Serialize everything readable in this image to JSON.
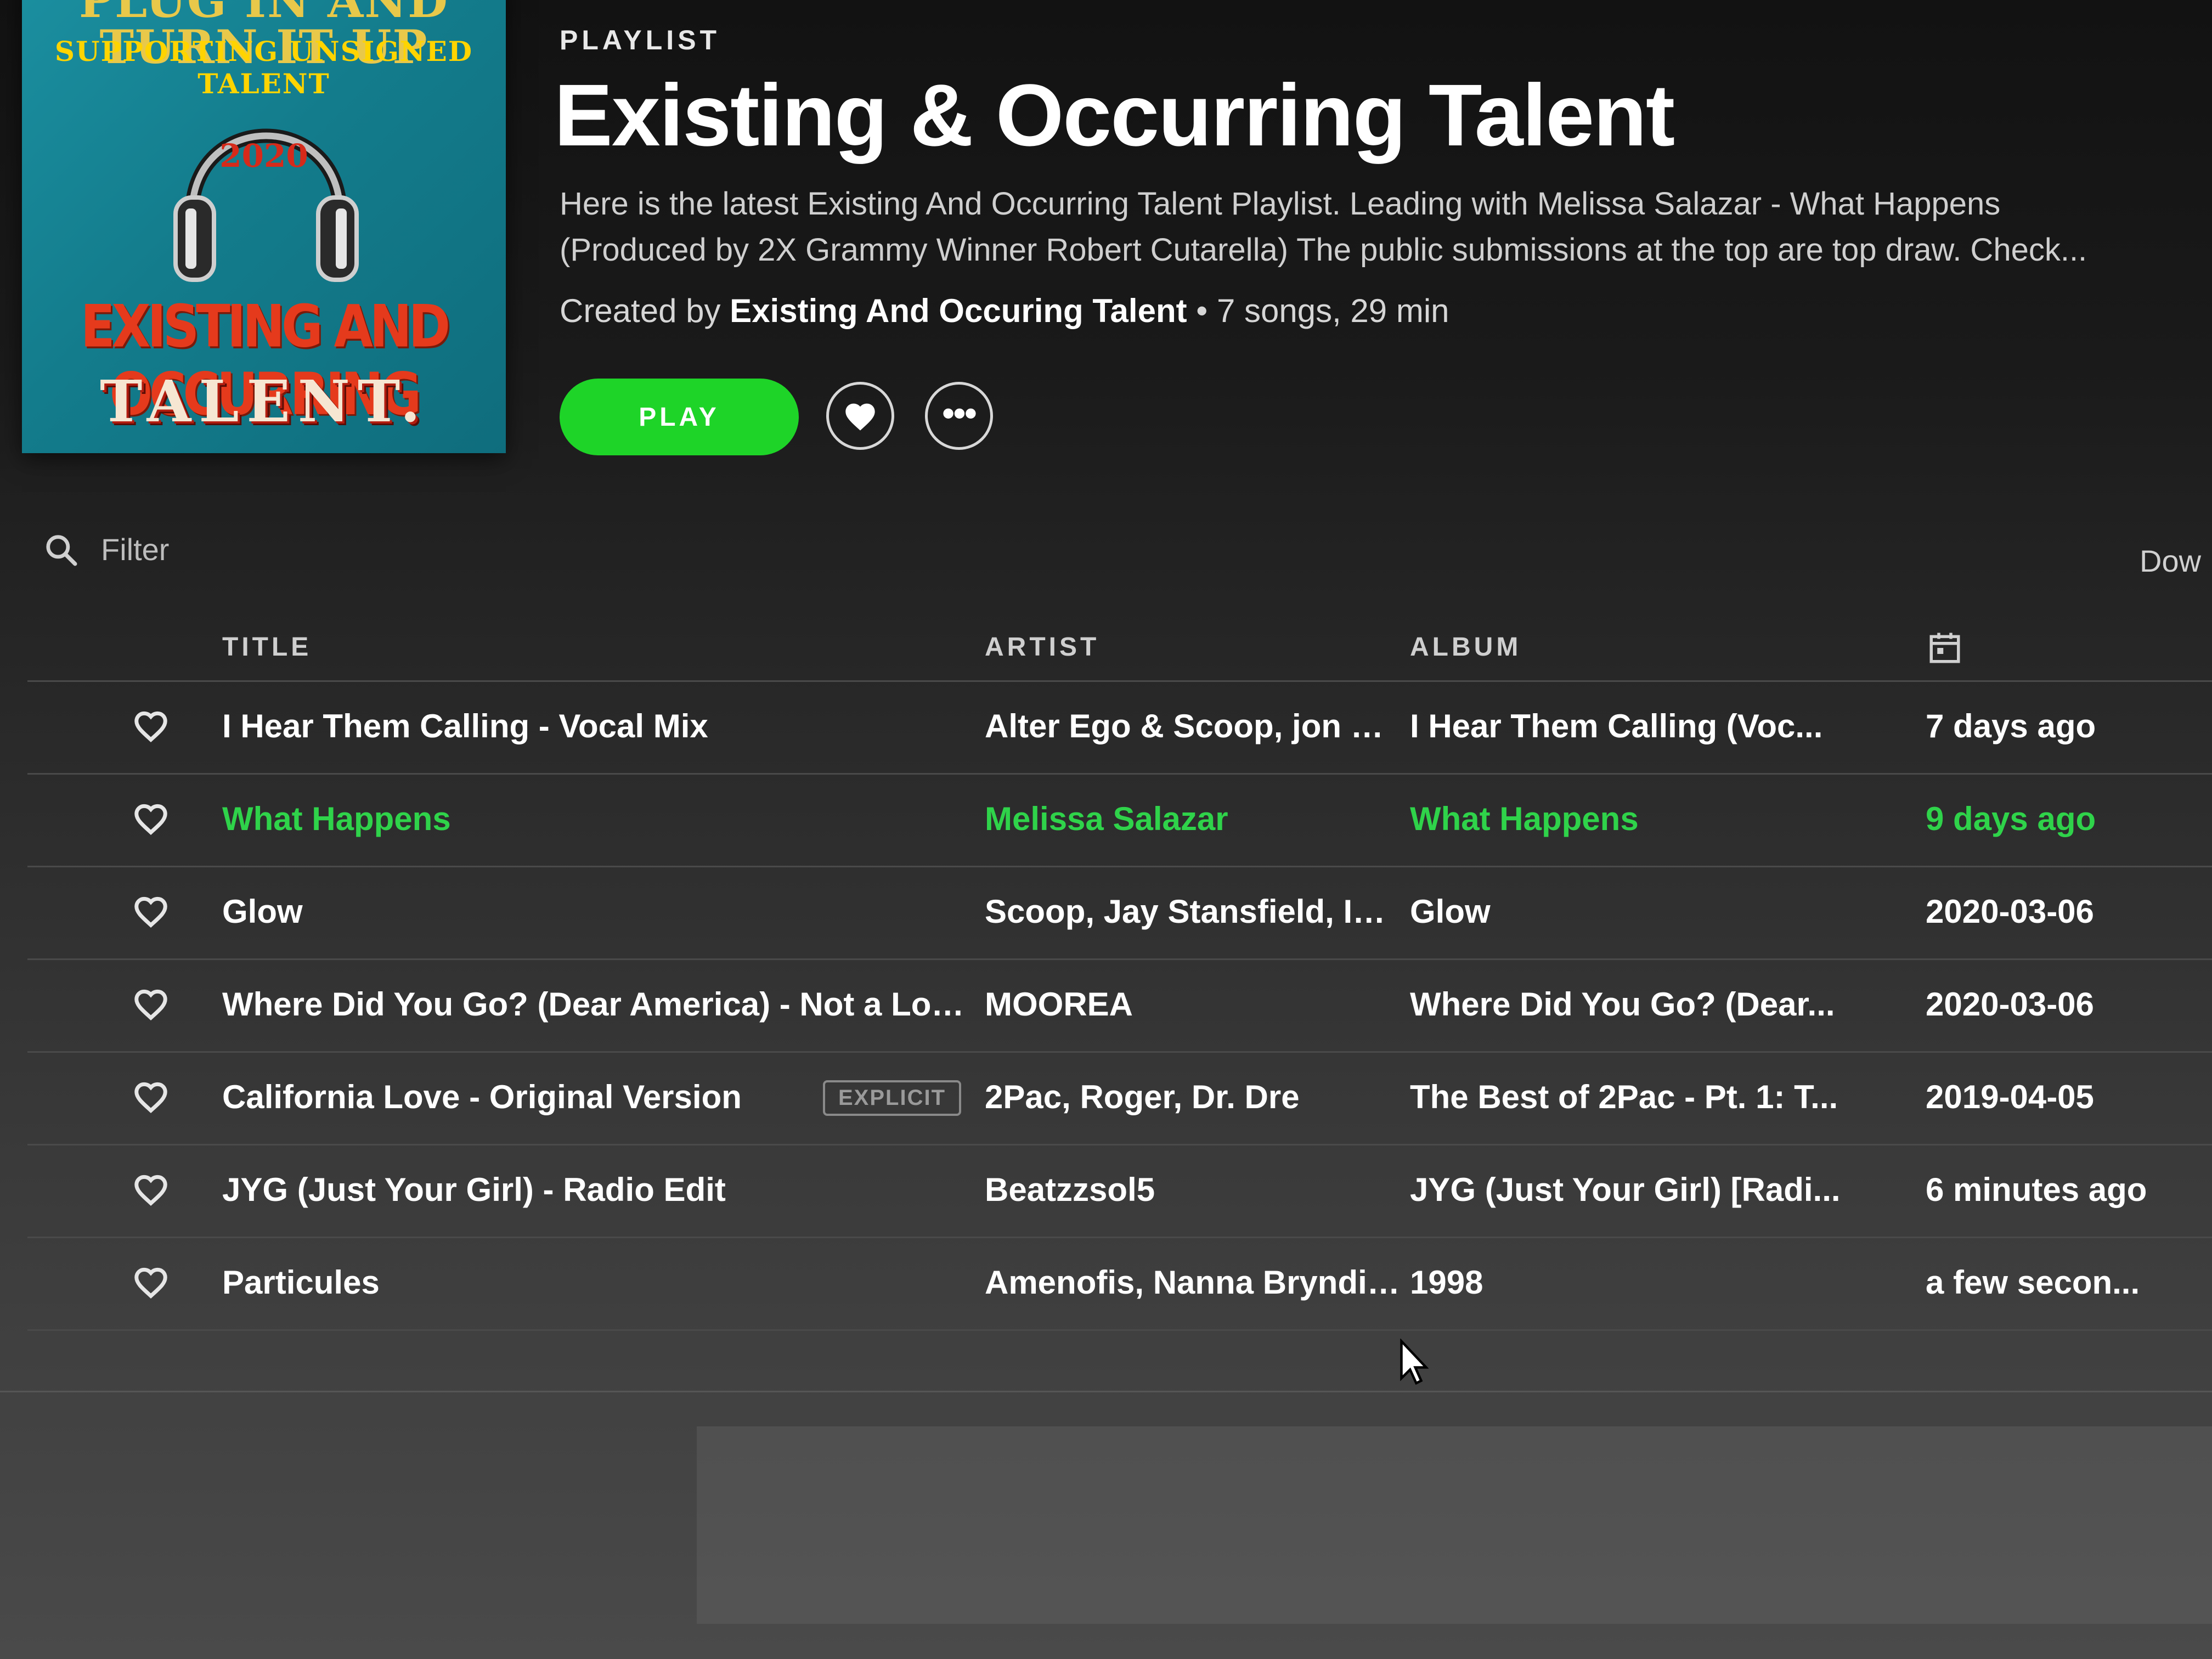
{
  "cover": {
    "line1": "PLUG IN AND TURN IT UP",
    "line2": "SUPPORTING UNSIGNED TALENT",
    "year": "2020",
    "name1": "EXISTING AND OCCURRING",
    "name2": "TALENT."
  },
  "header": {
    "type_label": "PLAYLIST",
    "title": "Existing & Occurring Talent",
    "description": "Here is the latest Existing And Occurring Talent Playlist. Leading with Melissa Salazar - What Happens (Produced by 2X Grammy Winner Robert Cutarella) The public submissions at the top are top draw. Check...",
    "created_by_prefix": "Created by",
    "creator": "Existing And Occuring Talent",
    "stats": " • 7 songs, 29 min"
  },
  "actions": {
    "play_label": "PLAY",
    "like_icon": "heart-icon",
    "more_label": "•••"
  },
  "filter": {
    "placeholder": "Filter"
  },
  "downloads_label": "Dow",
  "table": {
    "columns": {
      "title": "TITLE",
      "artist": "ARTIST",
      "album": "ALBUM",
      "date_icon": "calendar-icon"
    },
    "tracks": [
      {
        "title": "I Hear Them Calling - Vocal Mix",
        "artist": "Alter Ego & Scoop, jon gil...",
        "album": "I Hear Them Calling (Voc...",
        "added": "7 days ago",
        "explicit": "",
        "active": false
      },
      {
        "title": "What Happens",
        "artist": "Melissa Salazar",
        "album": "What Happens",
        "added": "9 days ago",
        "explicit": "",
        "active": true
      },
      {
        "title": "Glow",
        "artist": "Scoop, Jay Stansfield, Im...",
        "album": "Glow",
        "added": "2020-03-06",
        "explicit": "",
        "active": false
      },
      {
        "title": "Where Did You Go? (Dear America) - Not a Love ...",
        "artist": "MOOREA",
        "album": "Where Did You Go? (Dear...",
        "added": "2020-03-06",
        "explicit": "",
        "active": false
      },
      {
        "title": "California Love - Original Version",
        "artist": "2Pac, Roger, Dr. Dre",
        "album": "The Best of 2Pac - Pt. 1: T...",
        "added": "2019-04-05",
        "explicit": "EXPLICIT",
        "active": false
      },
      {
        "title": "JYG (Just Your Girl) - Radio Edit",
        "artist": "Beatzzsol5",
        "album": "JYG (Just Your Girl) [Radi...",
        "added": "6 minutes ago",
        "explicit": "",
        "active": false
      },
      {
        "title": "Particules",
        "artist": "Amenofis, Nanna Bryndis...",
        "album": "1998",
        "added": "a few secon...",
        "explicit": "",
        "active": false
      }
    ]
  },
  "colors": {
    "accent": "#1ed428",
    "active_text": "#2fd34a",
    "background": "#1e1e1e"
  }
}
